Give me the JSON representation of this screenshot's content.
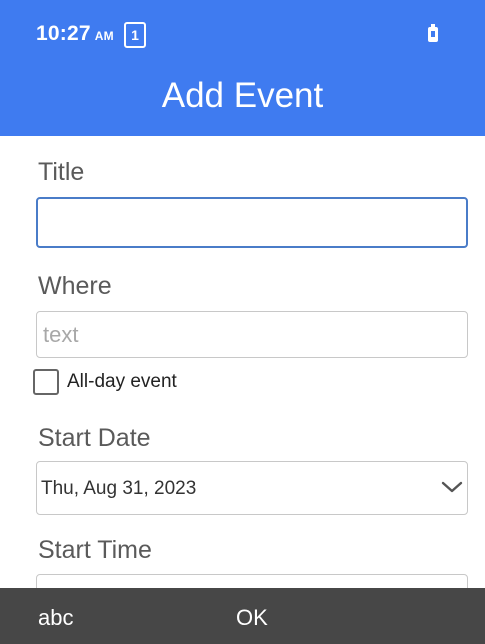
{
  "status_bar": {
    "time": "10:27",
    "ampm": "AM",
    "notification_count": "1",
    "battery_icon": "battery-charging-icon"
  },
  "header": {
    "title": "Add Event",
    "background_color": "#3f7bf0"
  },
  "form": {
    "title_label": "Title",
    "title_value": "",
    "where_label": "Where",
    "where_placeholder": "text",
    "where_value": "",
    "all_day_label": "All-day event",
    "all_day_checked": false,
    "start_date_label": "Start Date",
    "start_date_value": "Thu, Aug 31, 2023",
    "start_time_label": "Start Time",
    "start_time_value": ""
  },
  "soft_keys": {
    "left": "abc",
    "center": "OK"
  }
}
